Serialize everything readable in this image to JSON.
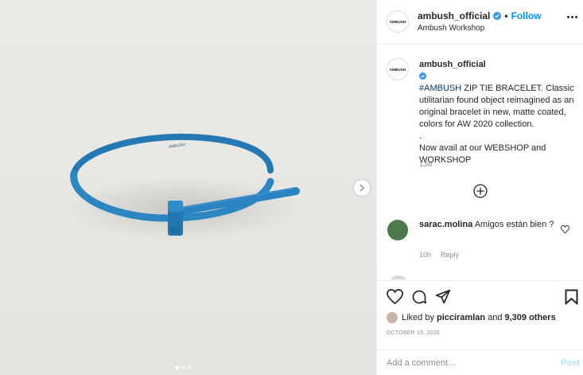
{
  "post": {
    "username": "ambush_official",
    "avatar_text": "AMBUSH",
    "location": "Ambush Workshop",
    "follow_label": "Follow",
    "separator": "•"
  },
  "caption": {
    "username": "ambush_official",
    "hashtag": "#AMBUSH",
    "text": " ZIP TIE BRACELET. Classic utilitarian found object reimagined as an original bracelet in new, matte coated, colors for AW 2020 collection.\n.\nNow avail at our WEBSHOP and WORKSHOP",
    "time": "13w"
  },
  "comment": {
    "username": "sarac.molina",
    "text": " Amigos están bien ?",
    "time": "10h",
    "reply_label": "Reply"
  },
  "likes": {
    "prefix": "Liked by",
    "user": "picciramlan",
    "joiner": "and",
    "count": "9,309 others"
  },
  "date": "OCTOBER 15, 2020",
  "add_comment": {
    "placeholder": "Add a comment…",
    "post_label": "Post"
  },
  "carousel": {
    "current": 1,
    "total": 3
  },
  "colors": {
    "accent": "#0095f6",
    "bracelet": "#2b86c2",
    "comment_avatar": "#4c7a4c"
  }
}
